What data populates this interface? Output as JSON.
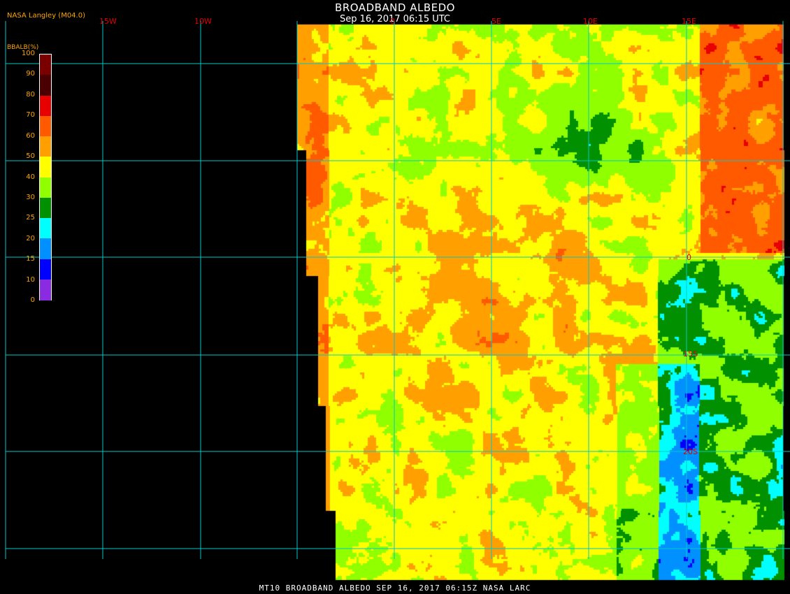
{
  "header": {
    "title": "BROADBAND ALBEDO",
    "subtitle": "Sep 16, 2017 06:15 UTC",
    "producer": "NASA Langley (M04.0)"
  },
  "footer": {
    "text": "MT10  BROADBAND ALBEDO   SEP 16, 2017 06:15Z   NASA LARC"
  },
  "colorbar": {
    "title": "BBALB(%)",
    "ticks": [
      "100",
      "90",
      "80",
      "70",
      "60",
      "50",
      "40",
      "30",
      "25",
      "20",
      "15",
      "10",
      "0"
    ],
    "colors": [
      "#7a0000",
      "#4a0000",
      "#e80000",
      "#ff5a00",
      "#ffa000",
      "#ffff00",
      "#90ff00",
      "#009000",
      "#00ffff",
      "#0090ff",
      "#0000ff",
      "#8a2be2"
    ]
  },
  "map": {
    "grid_color": "#00c8c8",
    "lon_labels": [
      "15W",
      "10W",
      "0",
      "5E",
      "10E",
      "15E"
    ],
    "lat_labels": [
      "0",
      "15S",
      "20S"
    ]
  }
}
